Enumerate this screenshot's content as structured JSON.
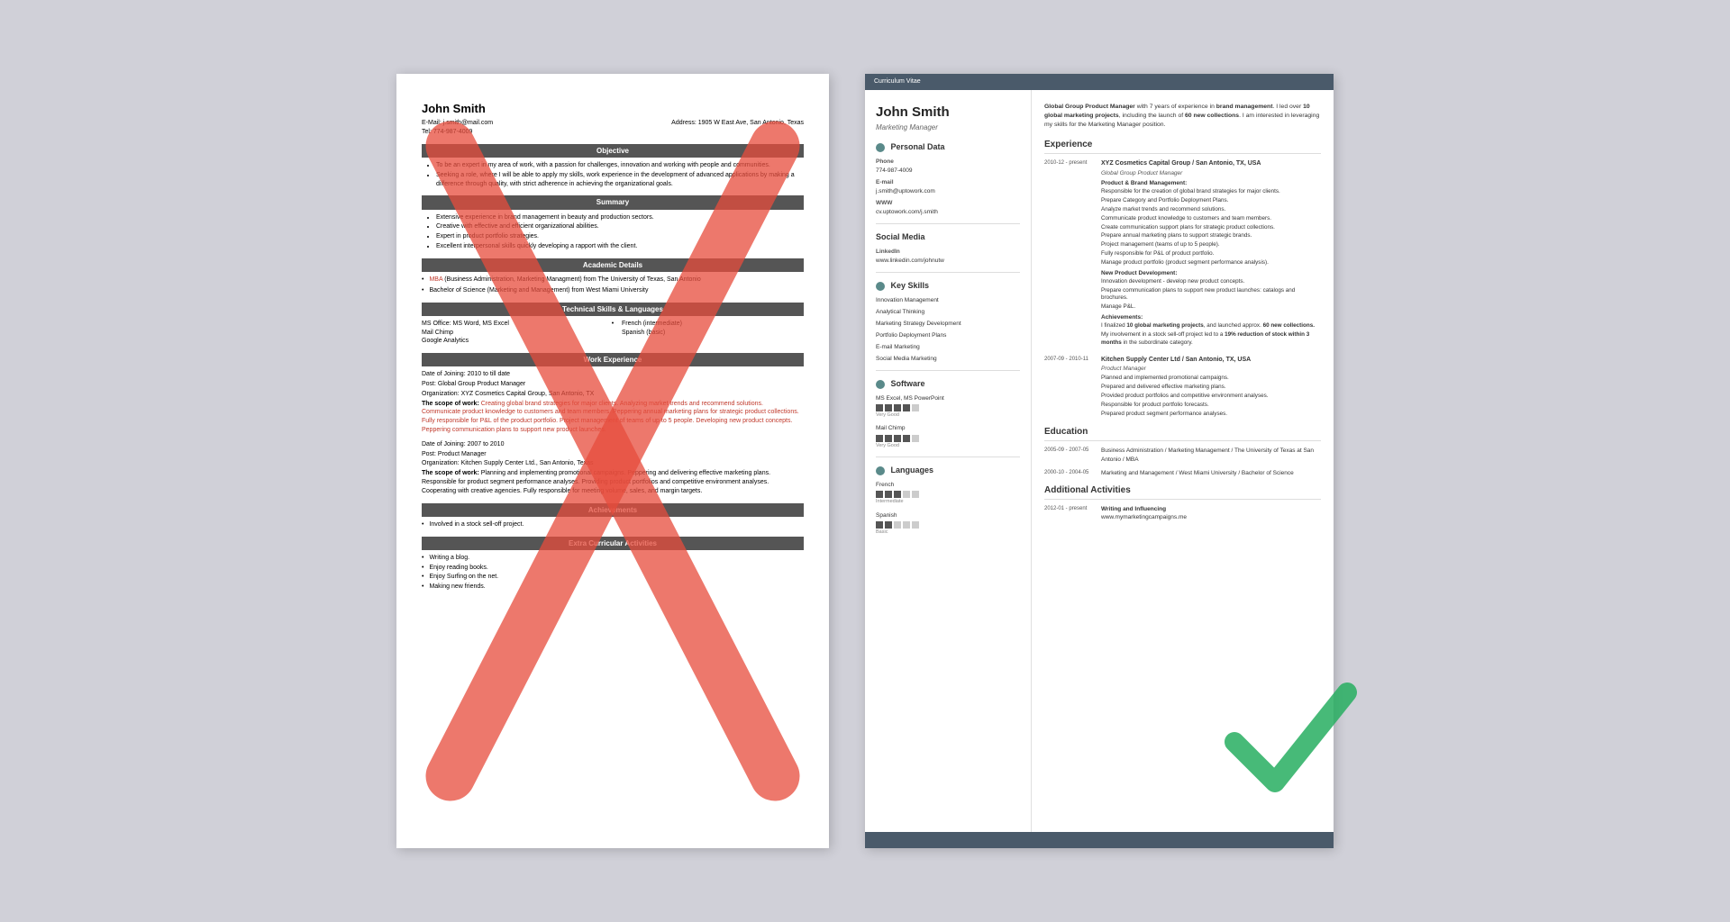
{
  "left_resume": {
    "name": "John Smith",
    "email": "E-Mail: j.smith@mail.com",
    "tel": "Tel: 774-987-4009",
    "address": "Address: 1905 W East Ave, San Antonio, Texas",
    "sections": {
      "objective": {
        "title": "Objective",
        "bullets": [
          "To be an expert in my area of work, with a passion for challenges, innovation and working with people and communities.",
          "Seeking a role, where I will be able to apply my skills, work experience in the development of advanced applications by making a difference through quality, with strict adherence in achieving the organizational goals."
        ]
      },
      "summary": {
        "title": "Summary",
        "bullets": [
          "Extensive experience in brand management in beauty and production sectors.",
          "Creative with effective and efficient organizational abilities.",
          "Expert in product portfolio strategies.",
          "Excellent interpersonal skills quickly developing a rapport with the client."
        ]
      },
      "academic": {
        "title": "Academic Details",
        "items": [
          "MBA (Business Administration, Marketing Managment) from The University of Texas, San Antonio",
          "Bachelor of Science (Marketing and Management) from West Miami University"
        ]
      },
      "technical": {
        "title": "Technical Skills & Languages",
        "skills_left": [
          "MS Office: MS Word, MS Excel",
          "Mail Chimp",
          "Google Analytics"
        ],
        "skills_right": [
          "French (intermediate)",
          "Spanish (basic)"
        ]
      },
      "work": {
        "title": "Work Experience",
        "entries": [
          {
            "joining": "Date of Joining: 2010 to till date",
            "post": "Post: Global Group Product Manager",
            "org": "Organization: XYZ Cosmetics Capital Group, San Antonio, TX",
            "scope_label": "The scope of work:",
            "scope": "Creating global brand strategies for major clients. Analyzing market trends and recommend solutions. Communicate product knowledge to customers and team members. Peppering annual marketing plans for strategic product collections. Fully responsible for P&L of the product portfolio. Project management of teams of up to 5 people. Developing new product concepts. Peppering communication plans to support new product launches."
          },
          {
            "joining": "Date of Joining: 2007 to 2010",
            "post": "Post: Product Manager",
            "org": "Organization: Kitchen Supply Center Ltd., San Antonio, Texas",
            "scope_label": "The scope of work:",
            "scope": "Planning and implementing promotional campaigns. Peppering and delivering effective marketing plans. Responsible for product segment performance analyses. Providing product portfolios and competitive environment analyses. Cooperating with creative agencies. Fully responsible for meeting volume, sales, and margin targets."
          }
        ]
      },
      "achievements": {
        "title": "Achievements",
        "items": [
          "Involved in a stock sell-off project."
        ]
      },
      "extra": {
        "title": "Extra Curricular Activities",
        "items": [
          "Writing a blog.",
          "Enjoy reading books.",
          "Enjoy Surfing on the net.",
          "Making new friends."
        ]
      }
    }
  },
  "right_resume": {
    "cv_label": "Curriculum Vitae",
    "name": "John Smith",
    "title": "Marketing Manager",
    "intro": "Global Group Product Manager with 7 years of experience in brand management. I led over 10 global marketing projects, including the launch of 60 new collections. I am interested in leveraging my skills for the Marketing Manager position.",
    "personal_data": {
      "section_title": "Personal Data",
      "phone_label": "Phone",
      "phone": "774-987-4009",
      "email_label": "E-mail",
      "email": "j.smith@uptowork.com",
      "www_label": "WWW",
      "www": "cv.uptowork.com/j.smith",
      "social_label": "Social Media",
      "linkedin_label": "LinkedIn",
      "linkedin": "www.linkedin.com/johnutw"
    },
    "key_skills": {
      "section_title": "Key Skills",
      "items": [
        "Innovation Management",
        "Analytical Thinking",
        "Marketing Strategy Development",
        "Portfolio Deployment Plans",
        "E-mail Marketing",
        "Social Media Marketing"
      ]
    },
    "software": {
      "section_title": "Software",
      "items": [
        {
          "name": "MS Excel, MS PowerPoint",
          "level": "Very Good",
          "filled": 4,
          "total": 5
        },
        {
          "name": "Mail Chimp",
          "level": "Very Good",
          "filled": 4,
          "total": 5
        }
      ]
    },
    "languages": {
      "section_title": "Languages",
      "items": [
        {
          "name": "French",
          "level": "Intermediate",
          "filled": 3,
          "total": 5
        },
        {
          "name": "Spanish",
          "level": "Basic",
          "filled": 2,
          "total": 5
        }
      ]
    },
    "experience": {
      "section_title": "Experience",
      "entries": [
        {
          "dates": "2010-12 - present",
          "org": "XYZ Cosmetics Capital Group / San Antonio, TX, USA",
          "role": "Global Group Product Manager",
          "subsections": [
            {
              "title": "Product & Brand Management:",
              "bullets": [
                "Responsible for the creation of global brand strategies for major clients.",
                "Prepare Category and Portfolio Deployment Plans.",
                "Analyze market trends and recommend solutions.",
                "Communicate product knowledge to customers and team members.",
                "Create communication support plans for strategic product collections.",
                "Prepare annual marketing plans to support strategic brands.",
                "Project management (teams of up to 5 people).",
                "Fully responsible for P&L of product portfolio.",
                "Manage product portfolio (product segment performance analysis)."
              ]
            },
            {
              "title": "New Product Development:",
              "bullets": [
                "Innovation development - develop new product concepts.",
                "Prepare communication plans to support new product launches: catalogs and brochures.",
                "Manage P&L."
              ]
            },
            {
              "title": "Achievements:",
              "bullets": [
                "I finalized 10 global marketing projects, and launched approx. 60 new collections.",
                "My involvement in a stock sell-off project led to a 19% reduction of stock within 3 months in the subordinate category."
              ]
            }
          ]
        },
        {
          "dates": "2007-09 - 2010-11",
          "org": "Kitchen Supply Center Ltd / San Antonio, TX, USA",
          "role": "Product Manager",
          "subsections": [
            {
              "title": "",
              "bullets": [
                "Planned and implemented promotional campaigns.",
                "Prepared and delivered effective marketing plans.",
                "Provided product portfolios and competitive environment analyses.",
                "Responsible for product portfolio forecasts.",
                "Prepared product segment performance analyses."
              ]
            }
          ]
        }
      ]
    },
    "education": {
      "section_title": "Education",
      "entries": [
        {
          "dates": "2005-09 - 2007-05",
          "content": "Business Administration / Marketing Management / The University of Texas at San Antonio / MBA"
        },
        {
          "dates": "2000-10 - 2004-05",
          "content": "Marketing and Management / West Miami University / Bachelor of Science"
        }
      ]
    },
    "additional": {
      "section_title": "Additional Activities",
      "entries": [
        {
          "dates": "2012-01 - present",
          "title": "Writing and Influencing",
          "content": "www.mymarketingcampaigns.me"
        }
      ]
    }
  }
}
